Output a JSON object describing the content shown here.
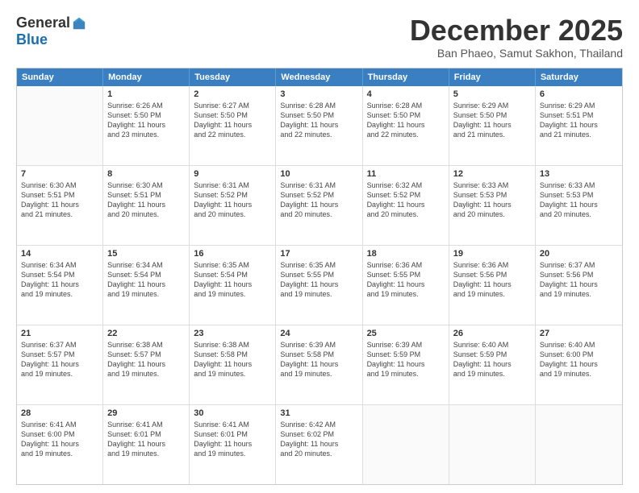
{
  "logo": {
    "general": "General",
    "blue": "Blue"
  },
  "title": "December 2025",
  "subtitle": "Ban Phaeo, Samut Sakhon, Thailand",
  "header_days": [
    "Sunday",
    "Monday",
    "Tuesday",
    "Wednesday",
    "Thursday",
    "Friday",
    "Saturday"
  ],
  "rows": [
    [
      {
        "day": "",
        "info": ""
      },
      {
        "day": "1",
        "info": "Sunrise: 6:26 AM\nSunset: 5:50 PM\nDaylight: 11 hours\nand 23 minutes."
      },
      {
        "day": "2",
        "info": "Sunrise: 6:27 AM\nSunset: 5:50 PM\nDaylight: 11 hours\nand 22 minutes."
      },
      {
        "day": "3",
        "info": "Sunrise: 6:28 AM\nSunset: 5:50 PM\nDaylight: 11 hours\nand 22 minutes."
      },
      {
        "day": "4",
        "info": "Sunrise: 6:28 AM\nSunset: 5:50 PM\nDaylight: 11 hours\nand 22 minutes."
      },
      {
        "day": "5",
        "info": "Sunrise: 6:29 AM\nSunset: 5:50 PM\nDaylight: 11 hours\nand 21 minutes."
      },
      {
        "day": "6",
        "info": "Sunrise: 6:29 AM\nSunset: 5:51 PM\nDaylight: 11 hours\nand 21 minutes."
      }
    ],
    [
      {
        "day": "7",
        "info": "Sunrise: 6:30 AM\nSunset: 5:51 PM\nDaylight: 11 hours\nand 21 minutes."
      },
      {
        "day": "8",
        "info": "Sunrise: 6:30 AM\nSunset: 5:51 PM\nDaylight: 11 hours\nand 20 minutes."
      },
      {
        "day": "9",
        "info": "Sunrise: 6:31 AM\nSunset: 5:52 PM\nDaylight: 11 hours\nand 20 minutes."
      },
      {
        "day": "10",
        "info": "Sunrise: 6:31 AM\nSunset: 5:52 PM\nDaylight: 11 hours\nand 20 minutes."
      },
      {
        "day": "11",
        "info": "Sunrise: 6:32 AM\nSunset: 5:52 PM\nDaylight: 11 hours\nand 20 minutes."
      },
      {
        "day": "12",
        "info": "Sunrise: 6:33 AM\nSunset: 5:53 PM\nDaylight: 11 hours\nand 20 minutes."
      },
      {
        "day": "13",
        "info": "Sunrise: 6:33 AM\nSunset: 5:53 PM\nDaylight: 11 hours\nand 20 minutes."
      }
    ],
    [
      {
        "day": "14",
        "info": "Sunrise: 6:34 AM\nSunset: 5:54 PM\nDaylight: 11 hours\nand 19 minutes."
      },
      {
        "day": "15",
        "info": "Sunrise: 6:34 AM\nSunset: 5:54 PM\nDaylight: 11 hours\nand 19 minutes."
      },
      {
        "day": "16",
        "info": "Sunrise: 6:35 AM\nSunset: 5:54 PM\nDaylight: 11 hours\nand 19 minutes."
      },
      {
        "day": "17",
        "info": "Sunrise: 6:35 AM\nSunset: 5:55 PM\nDaylight: 11 hours\nand 19 minutes."
      },
      {
        "day": "18",
        "info": "Sunrise: 6:36 AM\nSunset: 5:55 PM\nDaylight: 11 hours\nand 19 minutes."
      },
      {
        "day": "19",
        "info": "Sunrise: 6:36 AM\nSunset: 5:56 PM\nDaylight: 11 hours\nand 19 minutes."
      },
      {
        "day": "20",
        "info": "Sunrise: 6:37 AM\nSunset: 5:56 PM\nDaylight: 11 hours\nand 19 minutes."
      }
    ],
    [
      {
        "day": "21",
        "info": "Sunrise: 6:37 AM\nSunset: 5:57 PM\nDaylight: 11 hours\nand 19 minutes."
      },
      {
        "day": "22",
        "info": "Sunrise: 6:38 AM\nSunset: 5:57 PM\nDaylight: 11 hours\nand 19 minutes."
      },
      {
        "day": "23",
        "info": "Sunrise: 6:38 AM\nSunset: 5:58 PM\nDaylight: 11 hours\nand 19 minutes."
      },
      {
        "day": "24",
        "info": "Sunrise: 6:39 AM\nSunset: 5:58 PM\nDaylight: 11 hours\nand 19 minutes."
      },
      {
        "day": "25",
        "info": "Sunrise: 6:39 AM\nSunset: 5:59 PM\nDaylight: 11 hours\nand 19 minutes."
      },
      {
        "day": "26",
        "info": "Sunrise: 6:40 AM\nSunset: 5:59 PM\nDaylight: 11 hours\nand 19 minutes."
      },
      {
        "day": "27",
        "info": "Sunrise: 6:40 AM\nSunset: 6:00 PM\nDaylight: 11 hours\nand 19 minutes."
      }
    ],
    [
      {
        "day": "28",
        "info": "Sunrise: 6:41 AM\nSunset: 6:00 PM\nDaylight: 11 hours\nand 19 minutes."
      },
      {
        "day": "29",
        "info": "Sunrise: 6:41 AM\nSunset: 6:01 PM\nDaylight: 11 hours\nand 19 minutes."
      },
      {
        "day": "30",
        "info": "Sunrise: 6:41 AM\nSunset: 6:01 PM\nDaylight: 11 hours\nand 19 minutes."
      },
      {
        "day": "31",
        "info": "Sunrise: 6:42 AM\nSunset: 6:02 PM\nDaylight: 11 hours\nand 20 minutes."
      },
      {
        "day": "",
        "info": ""
      },
      {
        "day": "",
        "info": ""
      },
      {
        "day": "",
        "info": ""
      }
    ]
  ]
}
